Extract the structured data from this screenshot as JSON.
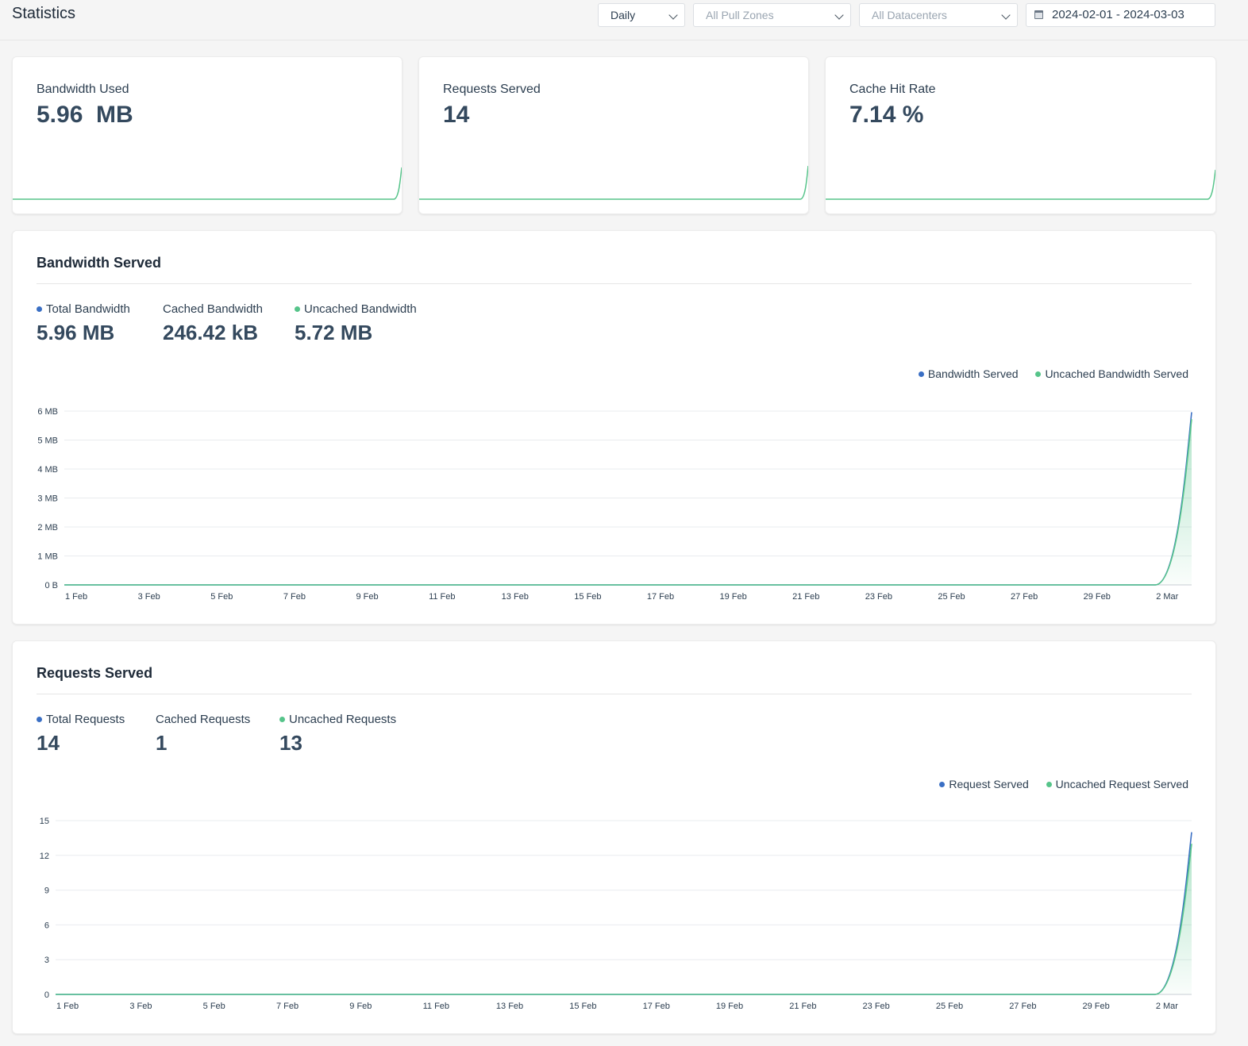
{
  "header": {
    "title": "Statistics",
    "period_select": "Daily",
    "pullzone_select": "All Pull Zones",
    "datacenter_select": "All Datacenters",
    "date_range": "2024-02-01 - 2024-03-03"
  },
  "summary": [
    {
      "label": "Bandwidth Used",
      "value": "5.96  MB"
    },
    {
      "label": "Requests Served",
      "value": "14"
    },
    {
      "label": "Cache Hit Rate",
      "value": "7.14 %"
    }
  ],
  "bandwidth": {
    "title": "Bandwidth Served",
    "metrics": [
      {
        "label": "Total Bandwidth",
        "value": "5.96 MB"
      },
      {
        "label": "Cached Bandwidth",
        "value": "246.42 kB"
      },
      {
        "label": "Uncached Bandwidth",
        "value": "5.72 MB"
      }
    ],
    "legend": [
      "Bandwidth Served",
      "Uncached Bandwidth Served"
    ]
  },
  "requests": {
    "title": "Requests Served",
    "metrics": [
      {
        "label": "Total Requests",
        "value": "14"
      },
      {
        "label": "Cached Requests",
        "value": "1"
      },
      {
        "label": "Uncached Requests",
        "value": "13"
      }
    ],
    "legend": [
      "Request Served",
      "Uncached Request Served"
    ]
  },
  "colors": {
    "blue": "#3a6fc4",
    "green": "#56c48a",
    "text": "#2c3e50"
  },
  "chart_data": [
    {
      "type": "area",
      "x_ticks": [
        "1 Feb",
        "3 Feb",
        "5 Feb",
        "7 Feb",
        "9 Feb",
        "11 Feb",
        "13 Feb",
        "15 Feb",
        "17 Feb",
        "19 Feb",
        "21 Feb",
        "23 Feb",
        "25 Feb",
        "27 Feb",
        "29 Feb",
        "2 Mar"
      ],
      "y_ticks": [
        "0 B",
        "1 MB",
        "2 MB",
        "3 MB",
        "4 MB",
        "5 MB",
        "6 MB"
      ],
      "ylim": [
        0,
        6
      ],
      "y_unit": "MB",
      "x_days": [
        "2024-02-01",
        "2024-03-03"
      ],
      "series": [
        {
          "name": "Bandwidth Served",
          "color": "#3a6fc4",
          "values": [
            0,
            0,
            0,
            0,
            0,
            0,
            0,
            0,
            0,
            0,
            0,
            0,
            0,
            0,
            0,
            0,
            0,
            0,
            0,
            0,
            0,
            0,
            0,
            0,
            0,
            0,
            0,
            0,
            0,
            0,
            0,
            5.96
          ]
        },
        {
          "name": "Uncached Bandwidth Served",
          "color": "#56c48a",
          "values": [
            0,
            0,
            0,
            0,
            0,
            0,
            0,
            0,
            0,
            0,
            0,
            0,
            0,
            0,
            0,
            0,
            0,
            0,
            0,
            0,
            0,
            0,
            0,
            0,
            0,
            0,
            0,
            0,
            0,
            0,
            0,
            5.72
          ]
        }
      ],
      "grid": true
    },
    {
      "type": "area",
      "x_ticks": [
        "1 Feb",
        "3 Feb",
        "5 Feb",
        "7 Feb",
        "9 Feb",
        "11 Feb",
        "13 Feb",
        "15 Feb",
        "17 Feb",
        "19 Feb",
        "21 Feb",
        "23 Feb",
        "25 Feb",
        "27 Feb",
        "29 Feb",
        "2 Mar"
      ],
      "y_ticks": [
        "0",
        "3",
        "6",
        "9",
        "12",
        "15"
      ],
      "ylim": [
        0,
        15
      ],
      "x_days": [
        "2024-02-01",
        "2024-03-03"
      ],
      "series": [
        {
          "name": "Request Served",
          "color": "#3a6fc4",
          "values": [
            0,
            0,
            0,
            0,
            0,
            0,
            0,
            0,
            0,
            0,
            0,
            0,
            0,
            0,
            0,
            0,
            0,
            0,
            0,
            0,
            0,
            0,
            0,
            0,
            0,
            0,
            0,
            0,
            0,
            0,
            0,
            14
          ]
        },
        {
          "name": "Uncached Request Served",
          "color": "#56c48a",
          "values": [
            0,
            0,
            0,
            0,
            0,
            0,
            0,
            0,
            0,
            0,
            0,
            0,
            0,
            0,
            0,
            0,
            0,
            0,
            0,
            0,
            0,
            0,
            0,
            0,
            0,
            0,
            0,
            0,
            0,
            0,
            0,
            13
          ]
        }
      ],
      "grid": true
    }
  ]
}
